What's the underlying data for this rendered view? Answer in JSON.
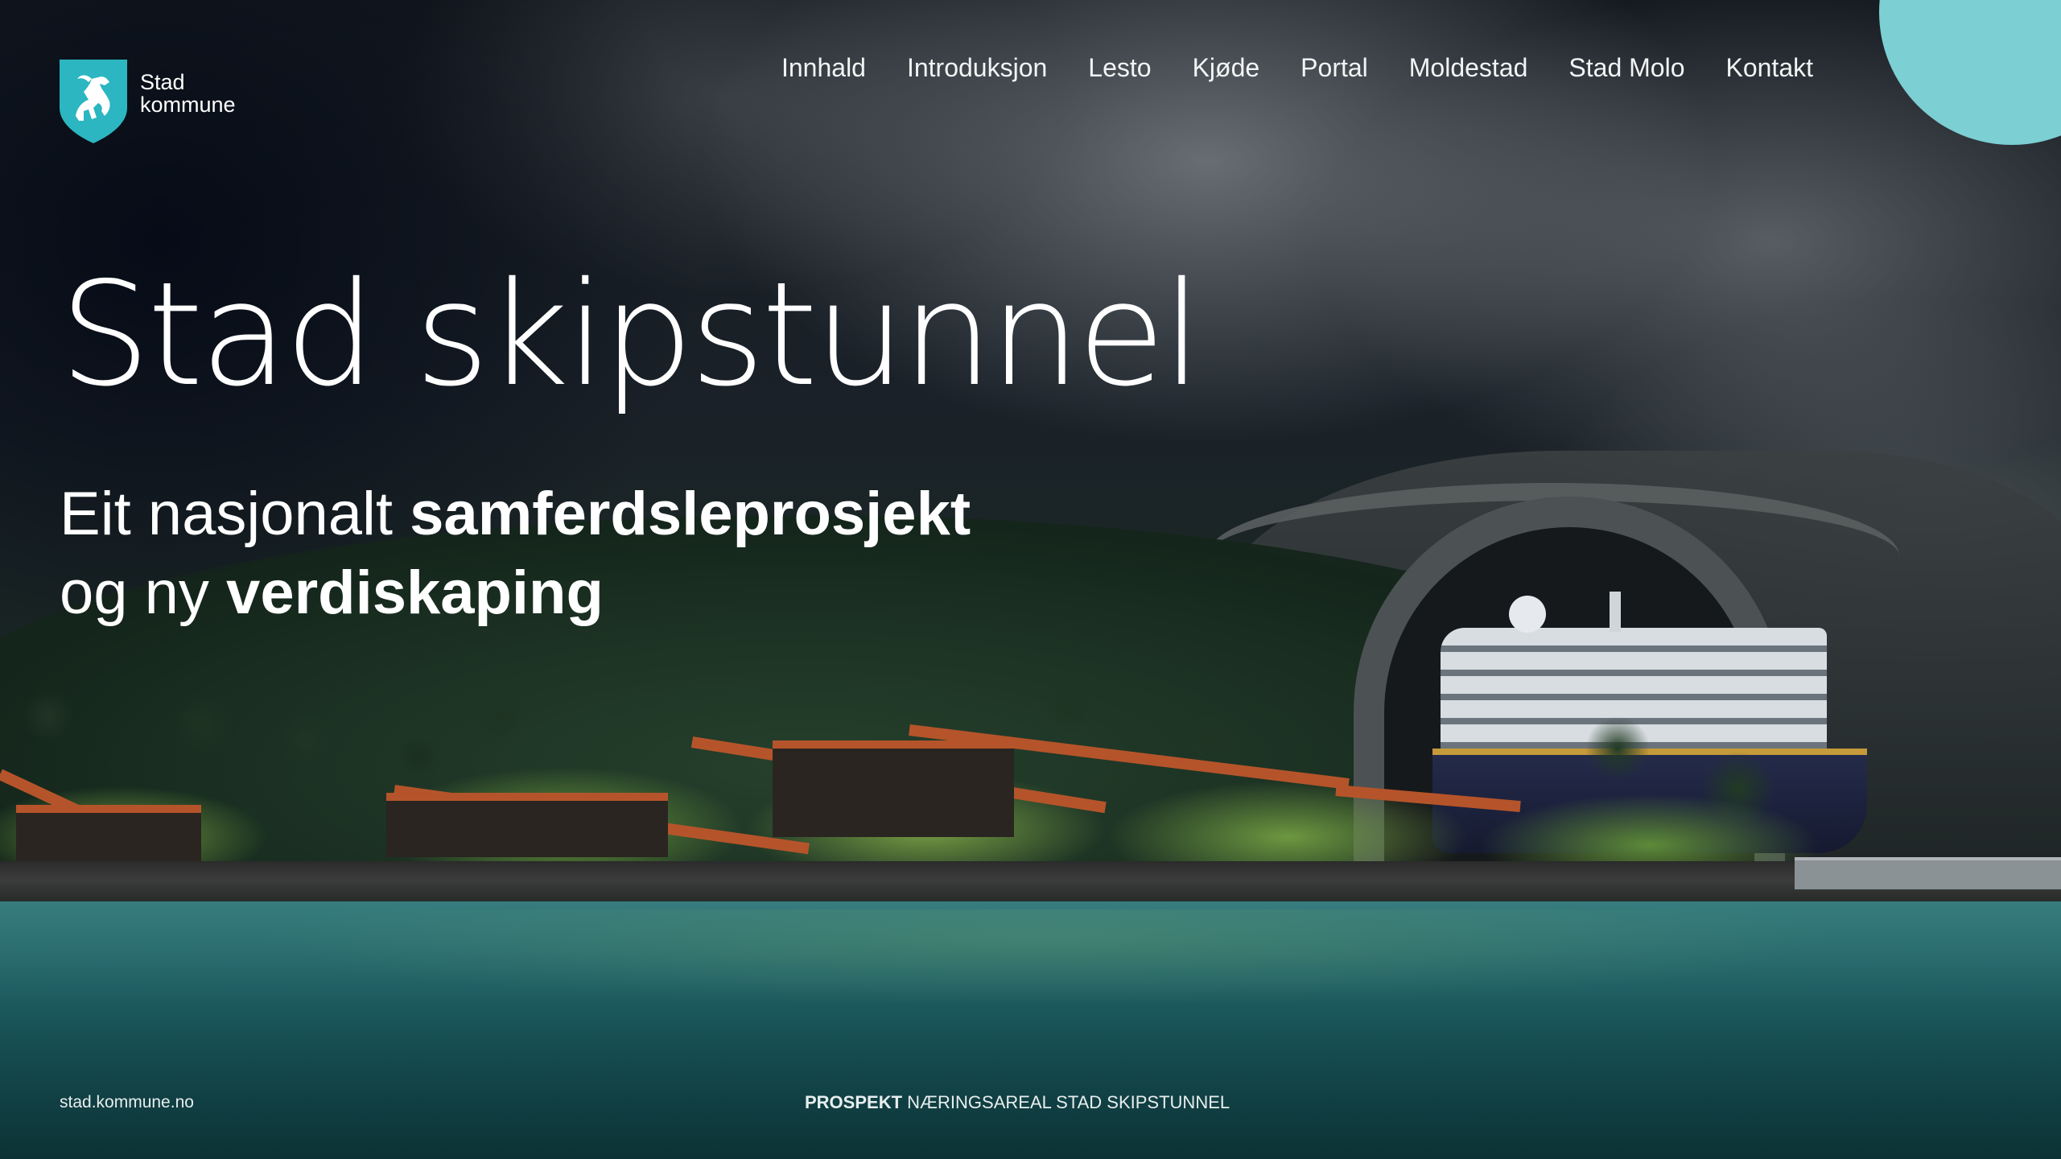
{
  "logo": {
    "line1": "Stad",
    "line2": "kommune",
    "accent_color": "#2bb6c1",
    "icon": "horse-shield-icon"
  },
  "nav": {
    "items": [
      {
        "label": "Innhald"
      },
      {
        "label": "Introduksjon"
      },
      {
        "label": "Lesto"
      },
      {
        "label": "Kjøde"
      },
      {
        "label": "Portal"
      },
      {
        "label": "Moldestad"
      },
      {
        "label": "Stad Molo"
      },
      {
        "label": "Kontakt"
      }
    ]
  },
  "hero": {
    "title": "Stad skipstunnel",
    "subtitle_line1_regular": "Eit nasjonalt ",
    "subtitle_line1_bold": "samferdsleprosjekt",
    "subtitle_line2_regular": "og ny ",
    "subtitle_line2_bold": "verdiskaping"
  },
  "footer": {
    "website": "stad.kommune.no",
    "label_bold": "PROSPEKT",
    "label_regular": " NÆRINGSAREAL STAD SKIPSTUNNEL"
  },
  "colors": {
    "accent_circle": "#7ccfd3",
    "water": "#1d5c60",
    "roof": "#b5542a"
  }
}
